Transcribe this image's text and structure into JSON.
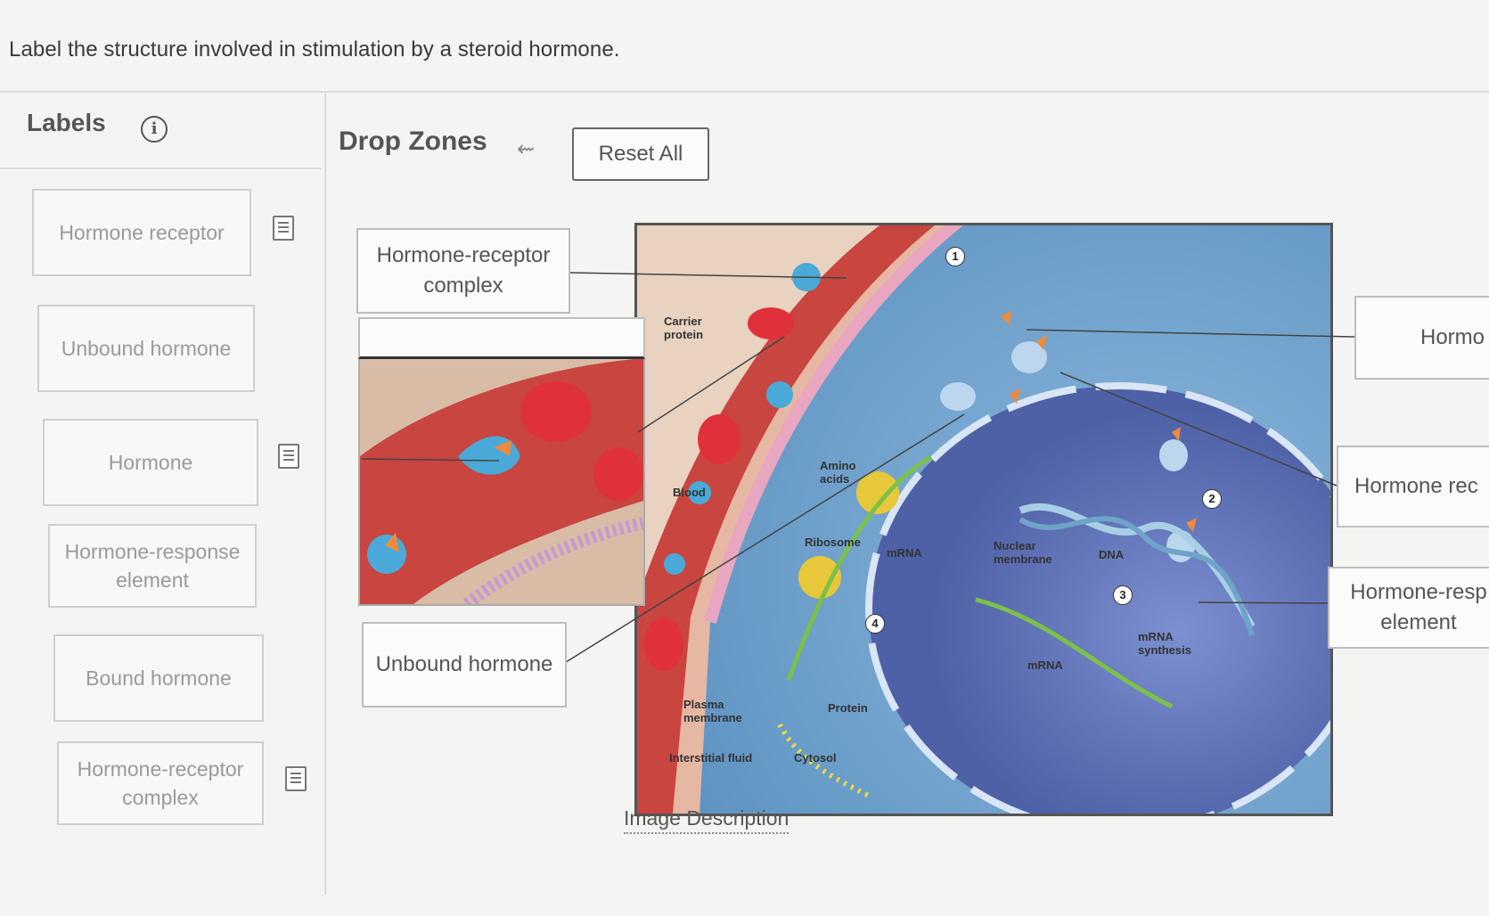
{
  "prompt": "Label the structure involved in stimulation by a steroid hormone.",
  "labels_panel": {
    "heading": "Labels",
    "info_icon": "i",
    "cards": [
      {
        "text": "Hormone receptor",
        "has_doc": true
      },
      {
        "text": "Unbound hormone",
        "has_doc": false
      },
      {
        "text": "Hormone",
        "has_doc": true
      },
      {
        "text": "Hormone-response element",
        "has_doc": false
      },
      {
        "text": "Bound hormone",
        "has_doc": false
      },
      {
        "text": "Hormone-receptor complex",
        "has_doc": true
      }
    ]
  },
  "drop_panel": {
    "heading": "Drop Zones",
    "back_arrow": "⇜",
    "reset_label": "Reset All",
    "zones": [
      {
        "text": "Hormone-receptor complex"
      },
      {
        "text": ""
      },
      {
        "text": "Unbound hormone"
      },
      {
        "text": "Hormo"
      },
      {
        "text": "Hormone rec"
      },
      {
        "text": "Hormone-resp element"
      }
    ],
    "caption": "Image Description"
  },
  "figure_labels": {
    "carrier_protein": "Carrier protein",
    "blood": "Blood",
    "amino_acids": "Amino acids",
    "ribosome": "Ribosome",
    "mrna_1": "mRNA",
    "nuclear_membrane": "Nuclear membrane",
    "dna": "DNA",
    "mrna_synthesis": "mRNA synthesis",
    "mrna_2": "mRNA",
    "plasma_membrane": "Plasma membrane",
    "protein": "Protein",
    "interstitial_fluid": "Interstitial fluid",
    "cytosol": "Cytosol",
    "step_numbers": [
      "1",
      "2",
      "3",
      "4"
    ]
  },
  "colors": {
    "blood_vessel": "#c9453f",
    "cytoplasm": "#7fa8cc",
    "nucleus": "#5b6fb0",
    "receptor": "#bcd6ee",
    "hormone": "#f08a3c"
  },
  "icons": {
    "info": "info-icon",
    "back": "undo-arrow-icon",
    "doc": "description-doc-icon"
  }
}
